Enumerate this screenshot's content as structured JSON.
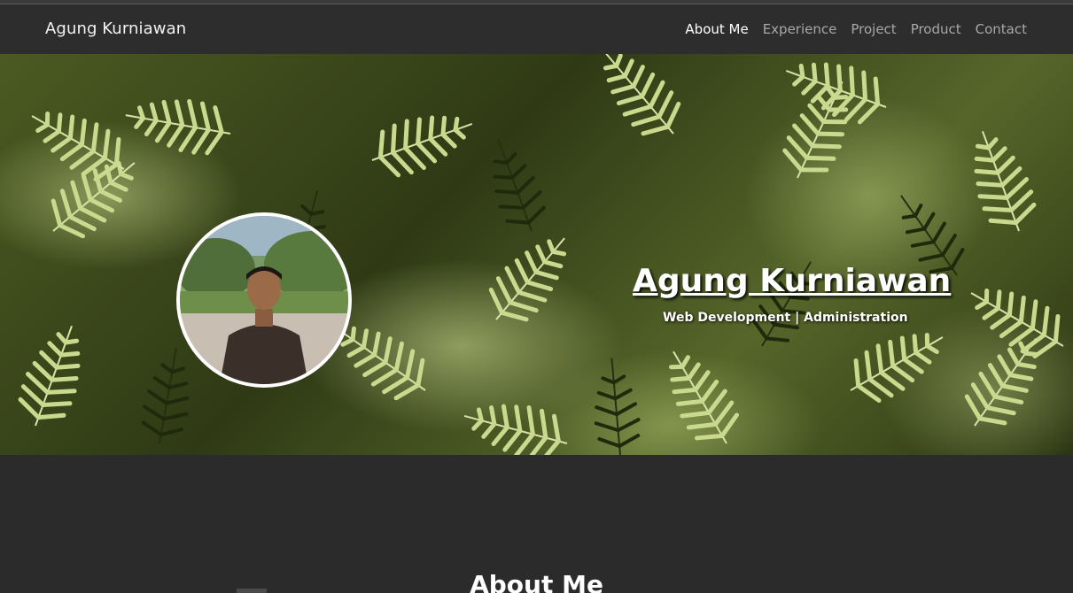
{
  "navbar": {
    "brand": "Agung Kurniawan",
    "links": [
      {
        "label": "About Me",
        "active": true
      },
      {
        "label": "Experience",
        "active": false
      },
      {
        "label": "Project",
        "active": false
      },
      {
        "label": "Product",
        "active": false
      },
      {
        "label": "Contact",
        "active": false
      }
    ]
  },
  "hero": {
    "name": "Agung Kurniawan",
    "subtitle": "Web Development | Administration",
    "background": "fern-leaves-photo",
    "avatar": "profile-photo"
  },
  "about": {
    "title": "About Me"
  },
  "colors": {
    "page_bg": "#2b2b2b",
    "navbar_bg": "#2d2d2d",
    "nav_inactive": "#a8a8a8",
    "nav_active": "#ffffff"
  }
}
